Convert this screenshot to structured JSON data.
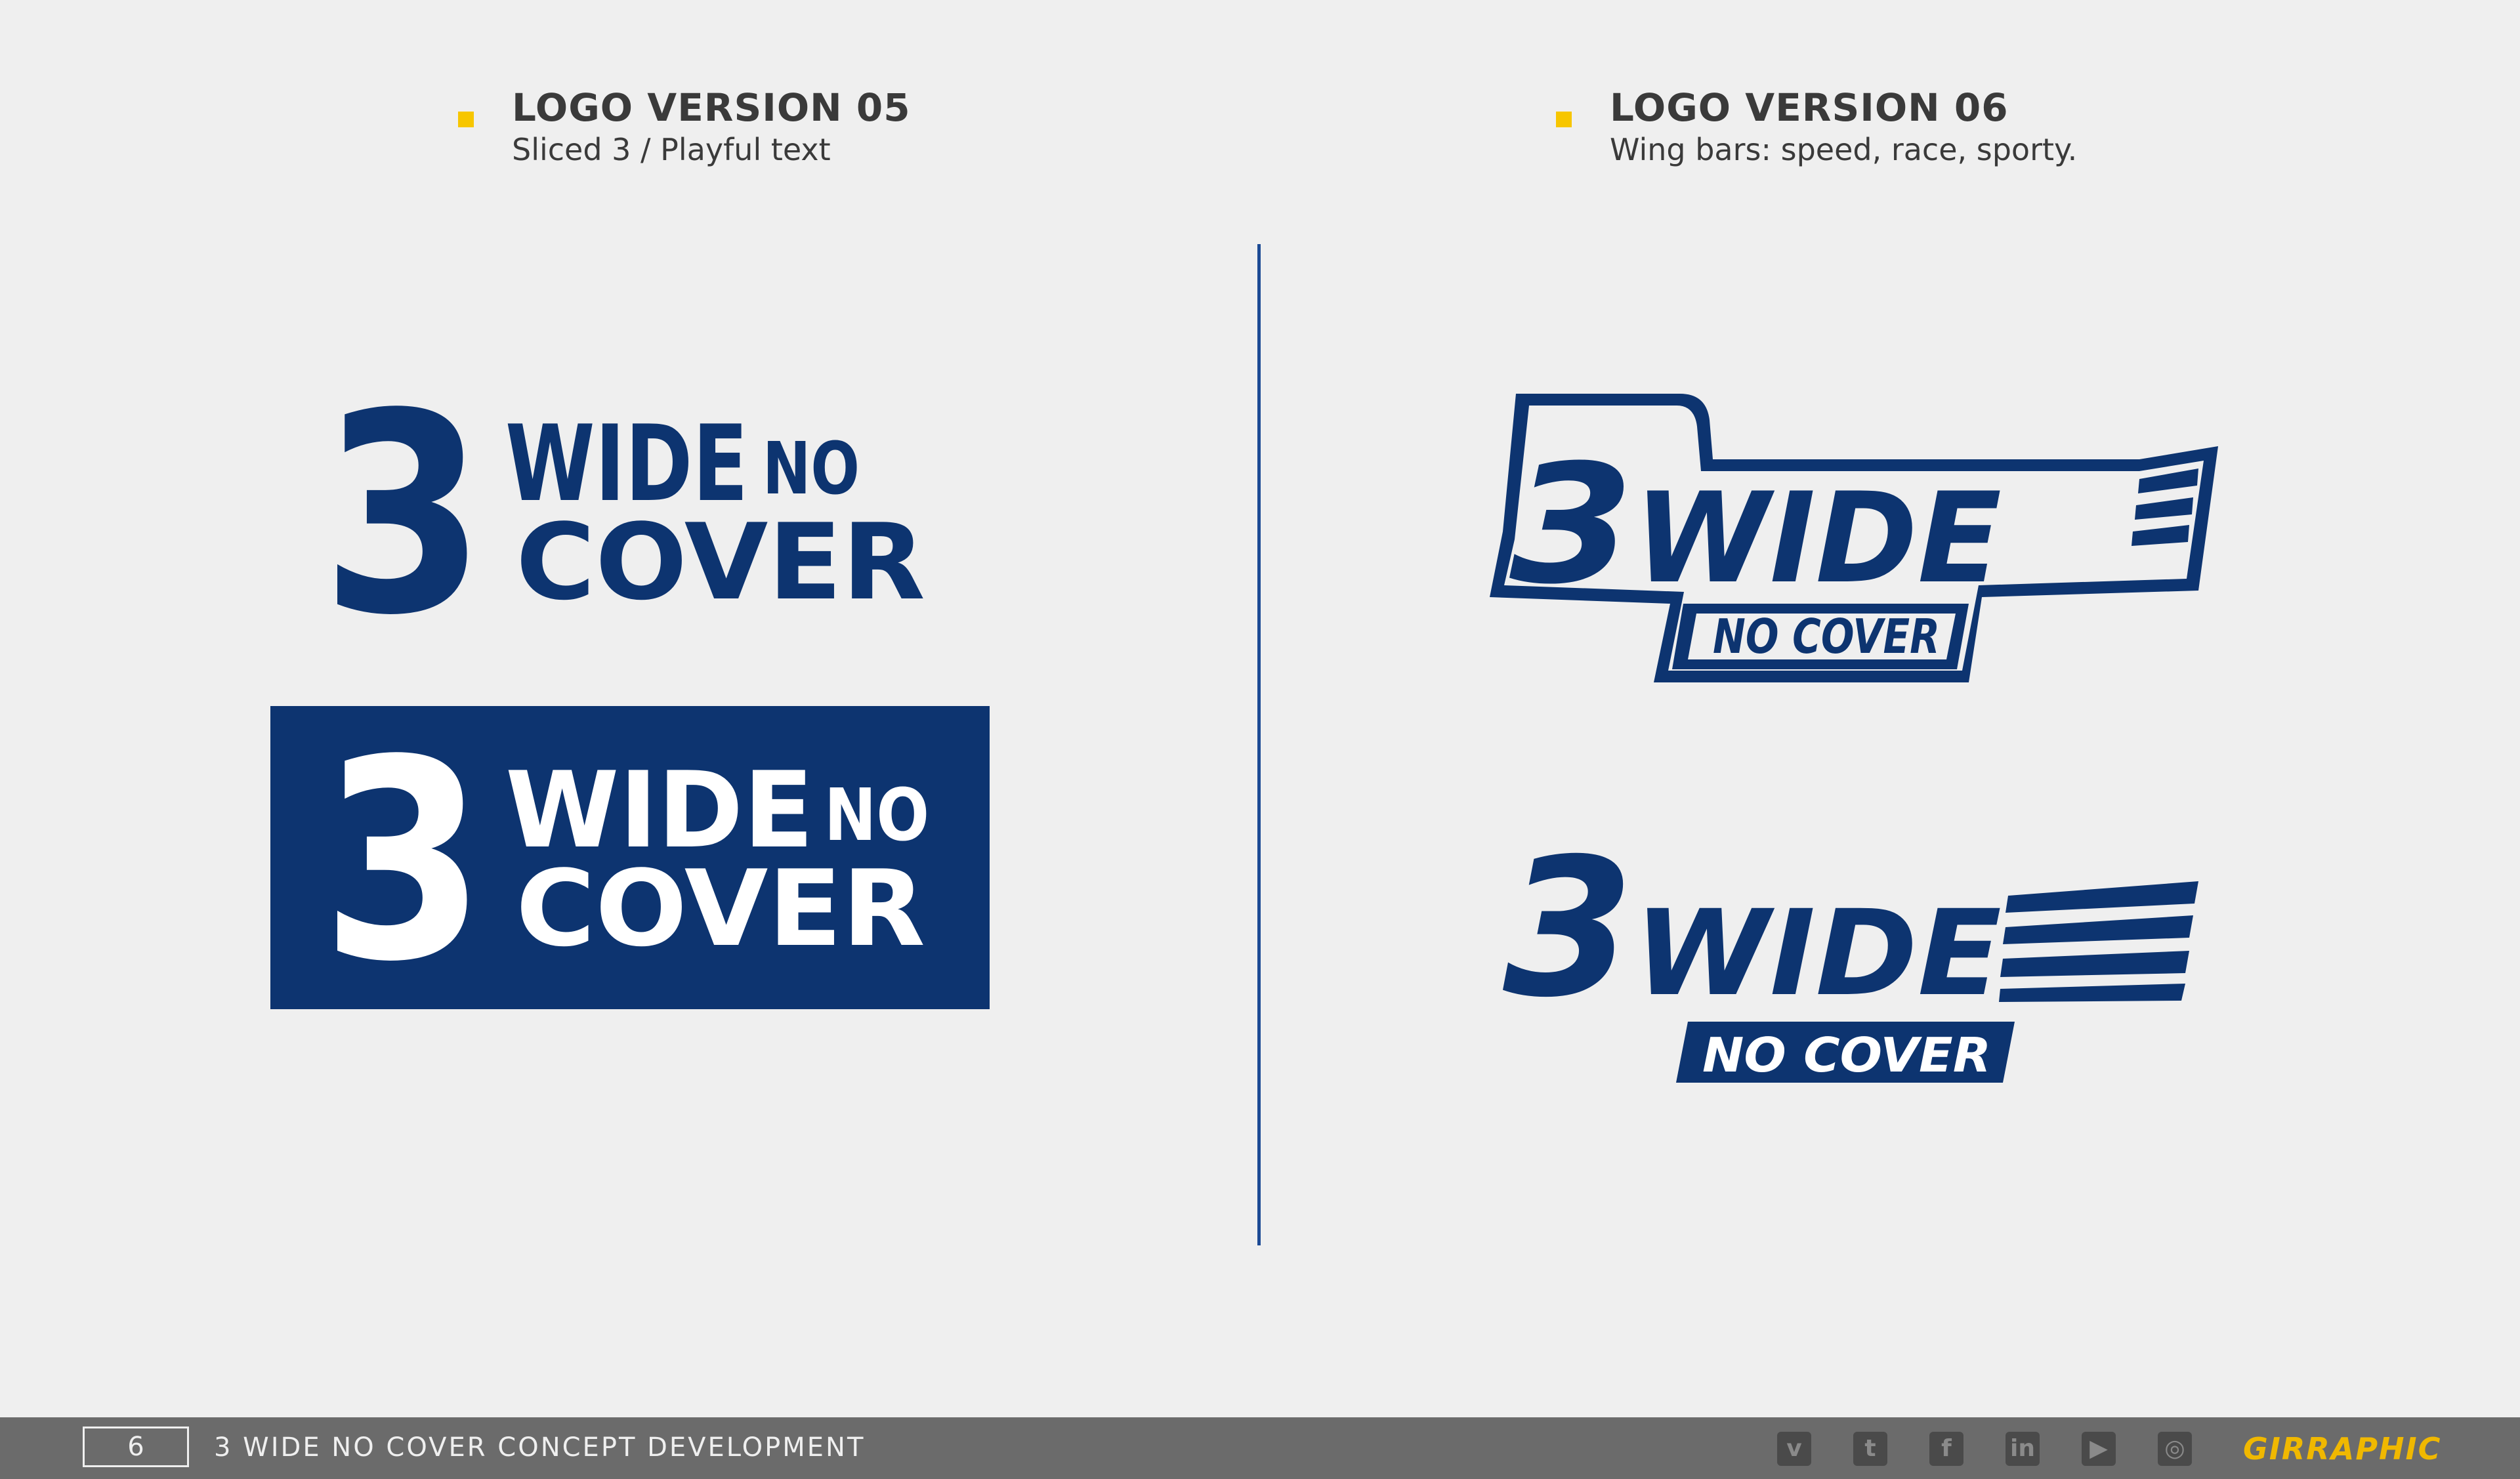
{
  "left": {
    "title": "LOGO VERSION 05",
    "subtitle": "Sliced 3 / Playful text"
  },
  "right": {
    "title": "LOGO VERSION 06",
    "subtitle": "Wing bars: speed, race, sporty."
  },
  "logo_text": {
    "numeral": "3",
    "wide": "WIDE",
    "no": "NO",
    "cover": "COVER",
    "no_cover": "NO COVER"
  },
  "footer": {
    "page_number": "6",
    "doc_title": "3 WIDE NO COVER CONCEPT DEVELOPMENT",
    "brand": "GIRRAPHIC",
    "social_icons": [
      "vimeo-icon",
      "twitter-icon",
      "facebook-icon",
      "linkedin-icon",
      "youtube-icon",
      "instagram-icon"
    ]
  },
  "colors": {
    "navy": "#0d3470",
    "background": "#efefef",
    "accent_yellow": "#f7c600",
    "footer_gray": "#6b6b6b"
  }
}
